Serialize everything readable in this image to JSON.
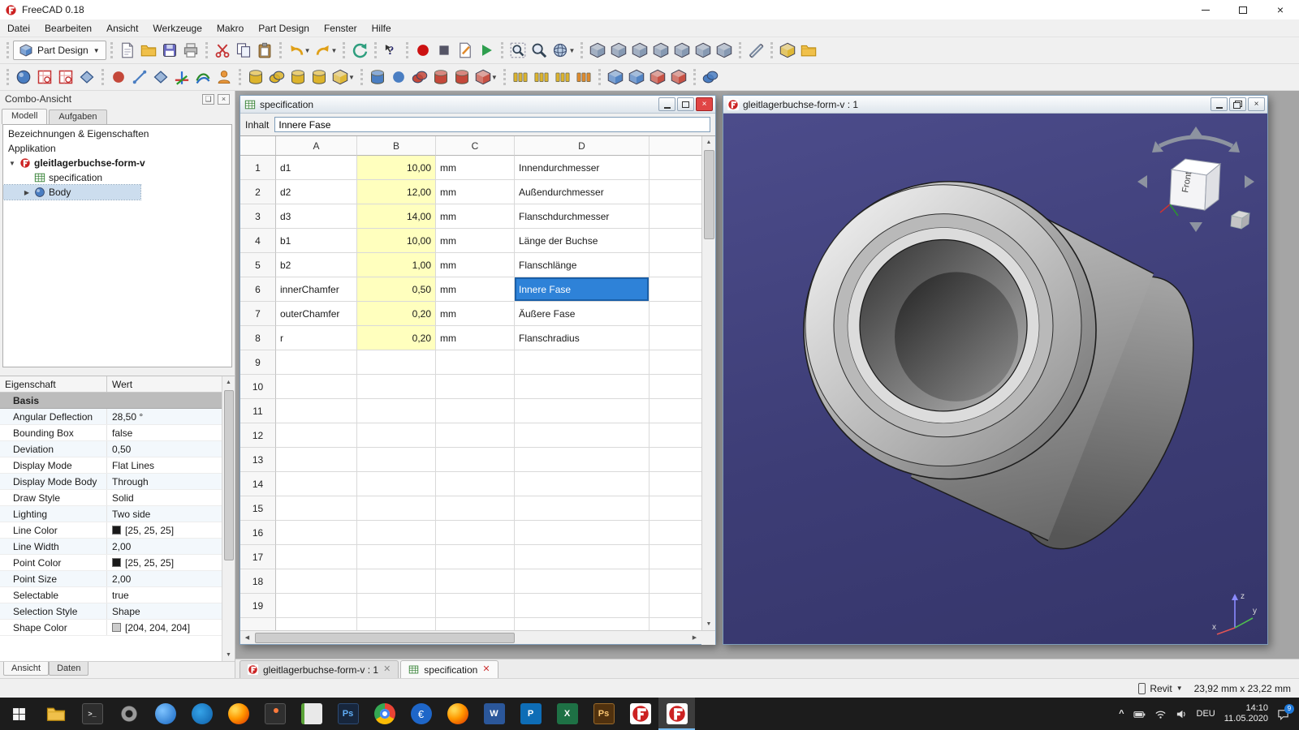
{
  "titlebar": {
    "title": "FreeCAD 0.18"
  },
  "menubar": {
    "items": [
      "Datei",
      "Bearbeiten",
      "Ansicht",
      "Werkzeuge",
      "Makro",
      "Part Design",
      "Fenster",
      "Hilfe"
    ]
  },
  "toolbar": {
    "workbench": "Part Design"
  },
  "combo": {
    "title": "Combo-Ansicht",
    "tab_modell": "Modell",
    "tab_aufgaben": "Aufgaben",
    "model_header": "Bezeichnungen & Eigenschaften",
    "application": "Applikation",
    "tree_document": "gleitlagerbuchse-form-v",
    "tree_spreadsheet": "specification",
    "tree_body": "Body",
    "prop_header_name": "Eigenschaft",
    "prop_header_value": "Wert",
    "prop_group": "Basis",
    "props": [
      {
        "name": "Angular Deflection",
        "value": "28,50 °"
      },
      {
        "name": "Bounding Box",
        "value": "false"
      },
      {
        "name": "Deviation",
        "value": "0,50"
      },
      {
        "name": "Display Mode",
        "value": "Flat Lines"
      },
      {
        "name": "Display Mode Body",
        "value": "Through"
      },
      {
        "name": "Draw Style",
        "value": "Solid"
      },
      {
        "name": "Lighting",
        "value": "Two side"
      },
      {
        "name": "Line Color",
        "value": "[25, 25, 25]",
        "swatch": "background:#191919"
      },
      {
        "name": "Line Width",
        "value": "2,00"
      },
      {
        "name": "Point Color",
        "value": "[25, 25, 25]",
        "swatch": "background:#191919"
      },
      {
        "name": "Point Size",
        "value": "2,00"
      },
      {
        "name": "Selectable",
        "value": "true"
      },
      {
        "name": "Selection Style",
        "value": "Shape"
      },
      {
        "name": "Shape Color",
        "value": "[204, 204, 204]",
        "swatch": "background:#cccccc"
      }
    ],
    "tab_ansicht": "Ansicht",
    "tab_daten": "Daten"
  },
  "spreadsheet": {
    "title": "specification",
    "content_label": "Inhalt",
    "content_value": "Innere Fase",
    "cols": [
      "A",
      "B",
      "C",
      "D"
    ],
    "rows": [
      {
        "n": "1",
        "a": "d1",
        "b": "10,00",
        "c": "mm",
        "d": "Innendurchmesser"
      },
      {
        "n": "2",
        "a": "d2",
        "b": "12,00",
        "c": "mm",
        "d": "Außendurchmesser"
      },
      {
        "n": "3",
        "a": "d3",
        "b": "14,00",
        "c": "mm",
        "d": "Flanschdurchmesser"
      },
      {
        "n": "4",
        "a": "b1",
        "b": "10,00",
        "c": "mm",
        "d": "Länge der Buchse"
      },
      {
        "n": "5",
        "a": "b2",
        "b": "1,00",
        "c": "mm",
        "d": "Flanschlänge"
      },
      {
        "n": "6",
        "a": "innerChamfer",
        "b": "0,50",
        "c": "mm",
        "d": "Innere Fase"
      },
      {
        "n": "7",
        "a": "outerChamfer",
        "b": "0,20",
        "c": "mm",
        "d": "Äußere Fase"
      },
      {
        "n": "8",
        "a": "r",
        "b": "0,20",
        "c": "mm",
        "d": "Flanschradius"
      },
      {
        "n": "9",
        "a": "",
        "b": "",
        "c": "",
        "d": ""
      },
      {
        "n": "10",
        "a": "",
        "b": "",
        "c": "",
        "d": ""
      },
      {
        "n": "11",
        "a": "",
        "b": "",
        "c": "",
        "d": ""
      },
      {
        "n": "12",
        "a": "",
        "b": "",
        "c": "",
        "d": ""
      },
      {
        "n": "13",
        "a": "",
        "b": "",
        "c": "",
        "d": ""
      },
      {
        "n": "14",
        "a": "",
        "b": "",
        "c": "",
        "d": ""
      },
      {
        "n": "15",
        "a": "",
        "b": "",
        "c": "",
        "d": ""
      },
      {
        "n": "16",
        "a": "",
        "b": "",
        "c": "",
        "d": ""
      },
      {
        "n": "17",
        "a": "",
        "b": "",
        "c": "",
        "d": ""
      },
      {
        "n": "18",
        "a": "",
        "b": "",
        "c": "",
        "d": ""
      },
      {
        "n": "19",
        "a": "",
        "b": "",
        "c": "",
        "d": ""
      }
    ],
    "selected_cell": "D6"
  },
  "view3d": {
    "title": "gleitlagerbuchse-form-v : 1",
    "navcube_front": "Front",
    "axis_x": "x",
    "axis_y": "y",
    "axis_z": "z"
  },
  "mditabs": {
    "tab1": "gleitlagerbuchse-form-v : 1",
    "tab2": "specification"
  },
  "statusbar": {
    "selector": "Revit",
    "dims": "23,92 mm x 23,22 mm"
  },
  "taskbar": {
    "apps": [
      {
        "label": ""
      },
      {
        "label": ">_"
      },
      {
        "label": ""
      },
      {
        "label": ""
      },
      {
        "label": ""
      },
      {
        "label": ""
      },
      {
        "label": ""
      },
      {
        "label": ""
      },
      {
        "label": "Ps"
      },
      {
        "label": ""
      },
      {
        "label": "€"
      },
      {
        "label": ""
      },
      {
        "label": "W"
      },
      {
        "label": "P"
      },
      {
        "label": "X"
      },
      {
        "label": "Ps"
      },
      {
        "label": ""
      },
      {
        "label": ""
      }
    ],
    "lang": "DEU",
    "time": "14:10",
    "date": "11.05.2020",
    "badge": "9"
  },
  "colors": {
    "selection_blue": "#2e82d8",
    "cell_yellow": "#ffffbe",
    "viewport_background": "#3d3d76"
  }
}
